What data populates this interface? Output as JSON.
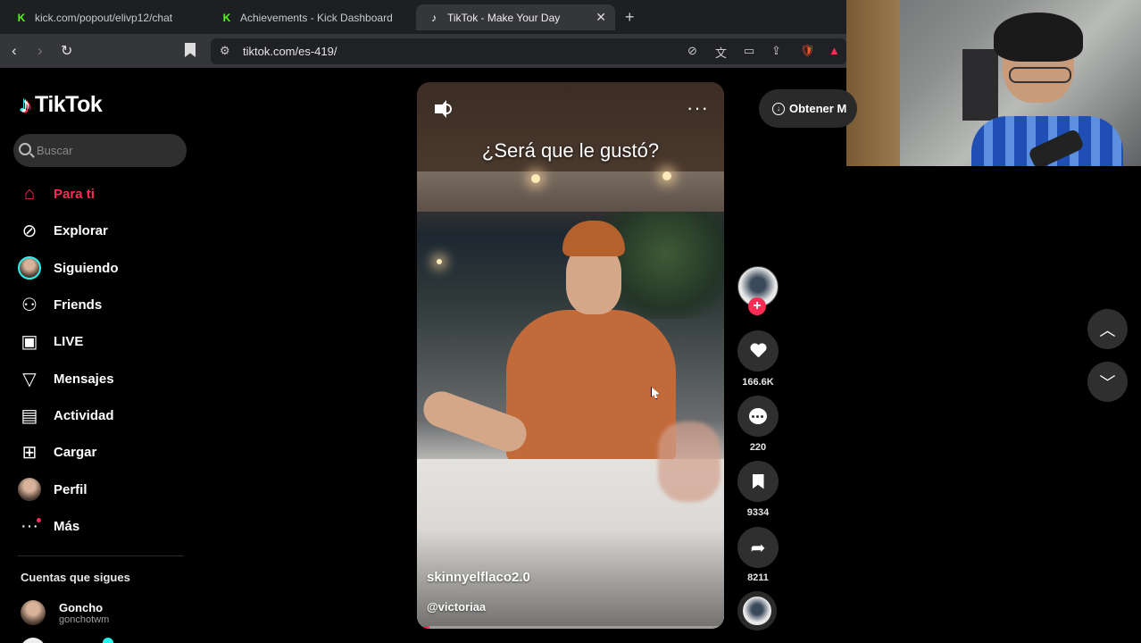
{
  "browser": {
    "tabs": [
      {
        "title": "kick.com/popout/elivp12/chat",
        "favicon": "kick-icon"
      },
      {
        "title": "Achievements - Kick Dashboard",
        "favicon": "kick-icon"
      },
      {
        "title": "TikTok - Make Your Day",
        "favicon": "tiktok-icon",
        "active": true
      }
    ],
    "new_tab": "+",
    "url": "tiktok.com/es-419/"
  },
  "sidebar": {
    "logo": "TikTok",
    "search_placeholder": "Buscar",
    "items": [
      {
        "label": "Para ti",
        "icon": "home-icon",
        "active": true
      },
      {
        "label": "Explorar",
        "icon": "compass-icon"
      },
      {
        "label": "Siguiendo",
        "icon": "avatar-icon"
      },
      {
        "label": "Friends",
        "icon": "friends-icon"
      },
      {
        "label": "LIVE",
        "icon": "live-icon"
      },
      {
        "label": "Mensajes",
        "icon": "send-icon"
      },
      {
        "label": "Actividad",
        "icon": "activity-icon"
      },
      {
        "label": "Cargar",
        "icon": "upload-icon"
      },
      {
        "label": "Perfil",
        "icon": "profile-avatar-icon"
      },
      {
        "label": "Más",
        "icon": "more-icon"
      }
    ],
    "following_title": "Cuentas que sigues",
    "accounts": [
      {
        "name": "Goncho",
        "handle": "gonchotwm"
      }
    ]
  },
  "video": {
    "caption": "¿Será que le gustó?",
    "author": "skinnyelflaco2.0",
    "handle": "@victoriaa",
    "progress": 0.04
  },
  "actions": {
    "likes": "166.6K",
    "comments": "220",
    "saves": "9334",
    "shares": "8211"
  },
  "get_app_label": "Obtener M",
  "colors": {
    "accent": "#fe2c55",
    "cyan": "#25f4ee",
    "kick_green": "#53fc18"
  }
}
